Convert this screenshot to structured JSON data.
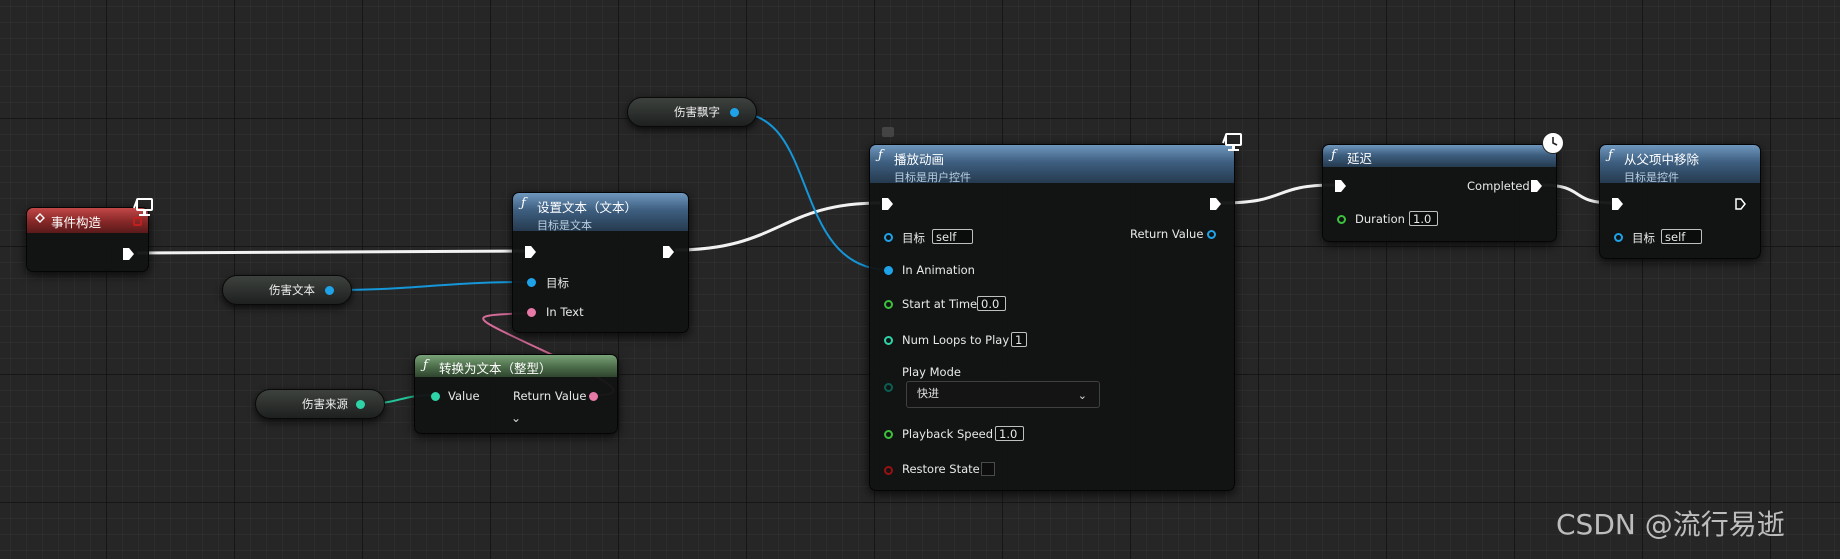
{
  "colors": {
    "exec": "#ffffff",
    "object_pin": "#1fa3e8",
    "text_pin": "#e779a8",
    "int_pin": "#2ed3a8",
    "float_pin": "#3cc13c",
    "bool_pin": "#9b1010",
    "enum_pin": "#0a5f52"
  },
  "nodes": {
    "event_construct": {
      "title": "事件构造"
    },
    "set_text": {
      "title": "设置文本（文本）",
      "subtitle": "目标是文本",
      "pin_target": "目标",
      "pin_in_text": "In Text"
    },
    "to_text": {
      "title": "转换为文本（整型）",
      "pin_value": "Value",
      "pin_return": "Return Value"
    },
    "play_anim": {
      "title": "播放动画",
      "subtitle": "目标是用户控件",
      "pin_target": "目标",
      "target_value": "self",
      "pin_return": "Return Value",
      "pin_in_anim": "In Animation",
      "pin_start": "Start at Time",
      "start_value": "0.0",
      "pin_loops": "Num Loops to Play",
      "loops_value": "1",
      "pin_mode": "Play Mode",
      "mode_value": "快进",
      "pin_speed": "Playback Speed",
      "speed_value": "1.0",
      "pin_restore": "Restore State"
    },
    "delay": {
      "title": "延迟",
      "pin_completed": "Completed",
      "pin_duration": "Duration",
      "duration_value": "1.0"
    },
    "remove": {
      "title": "从父项中移除",
      "subtitle": "目标是控件",
      "pin_target": "目标",
      "target_value": "self"
    }
  },
  "variables": {
    "damage_float": "伤害飘字",
    "damage_text": "伤害文本",
    "damage_source": "伤害来源"
  },
  "watermark": "CSDN @流行易逝"
}
